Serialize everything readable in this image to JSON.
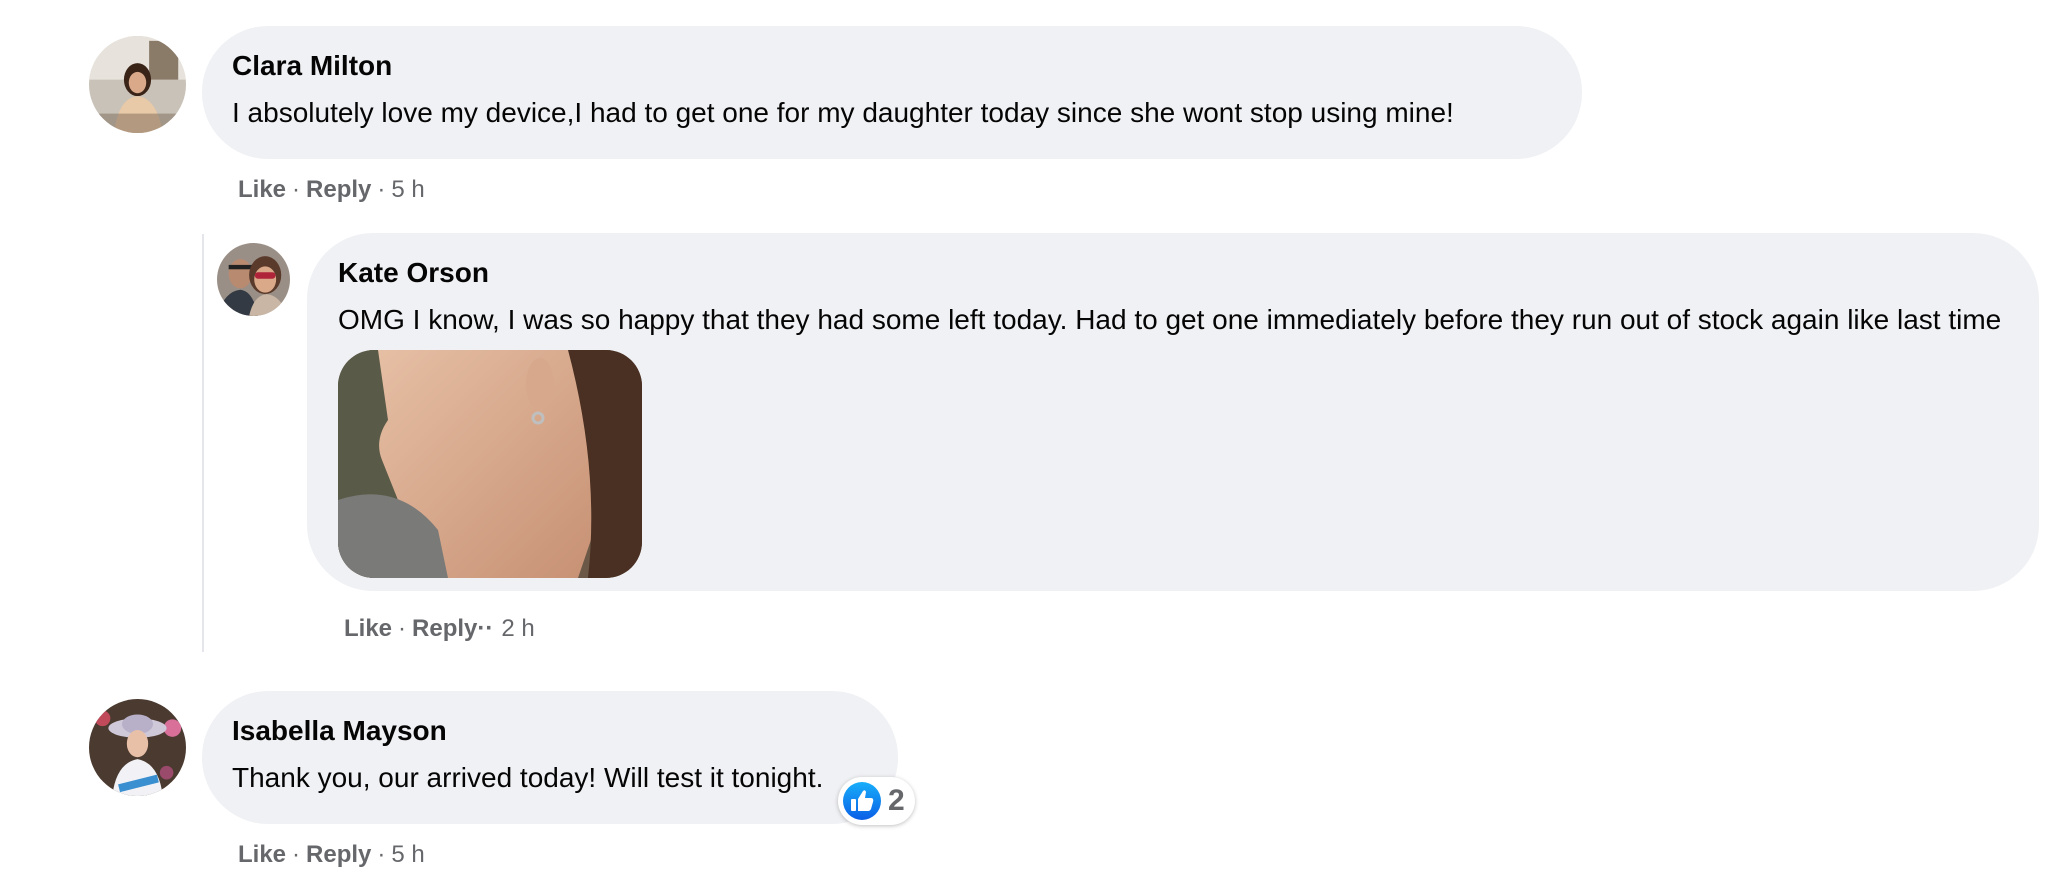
{
  "colors": {
    "bubble": "#f0f1f4",
    "muted_text": "#65676b",
    "like_blue": "#1877f2",
    "thread_line": "#e4e6eb"
  },
  "comments": [
    {
      "author": "Clara Milton",
      "text": "I absolutely love my device,I had to get one for my daughter today since she wont stop using mine!",
      "actions": {
        "like": "Like",
        "reply": "Reply",
        "time": "5 h"
      }
    },
    {
      "author": "Kate Orson",
      "text": "OMG I know, I was so happy that they had some left today. Had to get one immediately before they run out of stock again like last time",
      "actions": {
        "like": "Like",
        "reply": "Reply··",
        "time": "2 h"
      },
      "attachment_icon": "photo-attachment"
    },
    {
      "author": "Isabella Mayson",
      "text": "Thank you, our arrived today! Will test it tonight.",
      "actions": {
        "like": "Like",
        "reply": "Reply",
        "time": "5 h"
      },
      "reaction": {
        "icon": "thumbs-up-icon",
        "count": "2"
      }
    }
  ]
}
